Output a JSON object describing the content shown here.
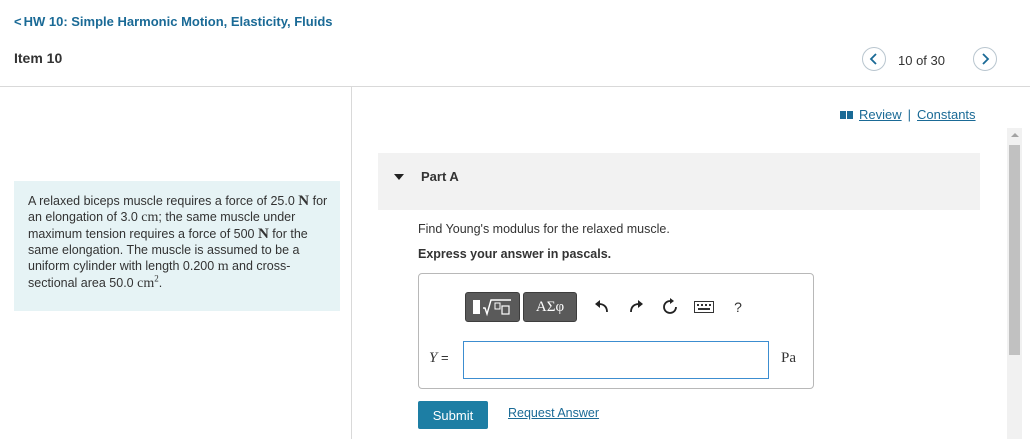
{
  "header": {
    "back_chevron": "<",
    "back_label": "HW 10: Simple Harmonic Motion, Elasticity, Fluids",
    "item_title": "Item 10",
    "item_count": "10 of 30"
  },
  "links": {
    "review": "Review",
    "separator": "|",
    "constants": "Constants"
  },
  "problem": {
    "t1": "A relaxed biceps muscle requires a force of 25.0 ",
    "u1": "N",
    "t2": " for an elongation of 3.0 ",
    "u2": "cm",
    "t3": "; the same muscle under maximum tension requires a force of 500 ",
    "u3": "N",
    "t4": " for the same elongation. The muscle is assumed to be a uniform cylinder with length 0.200 ",
    "u4": "m",
    "t5": " and cross-sectional area 50.0 ",
    "u5": "cm",
    "sup5": "2",
    "t6": "."
  },
  "part": {
    "label": "Part A",
    "question": "Find Young's modulus for the relaxed muscle.",
    "instruction": "Express your answer in pascals."
  },
  "answer": {
    "symbols_label": "ΑΣφ",
    "help_label": "?",
    "variable": "Y",
    "equals": " =",
    "value": "",
    "unit": "Pa"
  },
  "actions": {
    "submit_label": "Submit",
    "request_label": "Request Answer"
  },
  "colors": {
    "link_blue": "#1a6a96",
    "submit_bg": "#1d7ea4",
    "problem_bg": "#e6f3f5",
    "part_header_bg": "#f2f2f2",
    "toolbar_dark": "#5a5a5a"
  },
  "icons": {
    "back": "chevron-left-icon",
    "prev": "chevron-left-icon",
    "next": "chevron-right-icon",
    "review": "book-icon",
    "templates": "templates-icon",
    "undo": "undo-icon",
    "redo": "redo-icon",
    "reset": "reset-icon",
    "keyboard": "keyboard-icon",
    "help": "help-icon"
  },
  "scroll": {
    "position_fraction": 0.0
  }
}
